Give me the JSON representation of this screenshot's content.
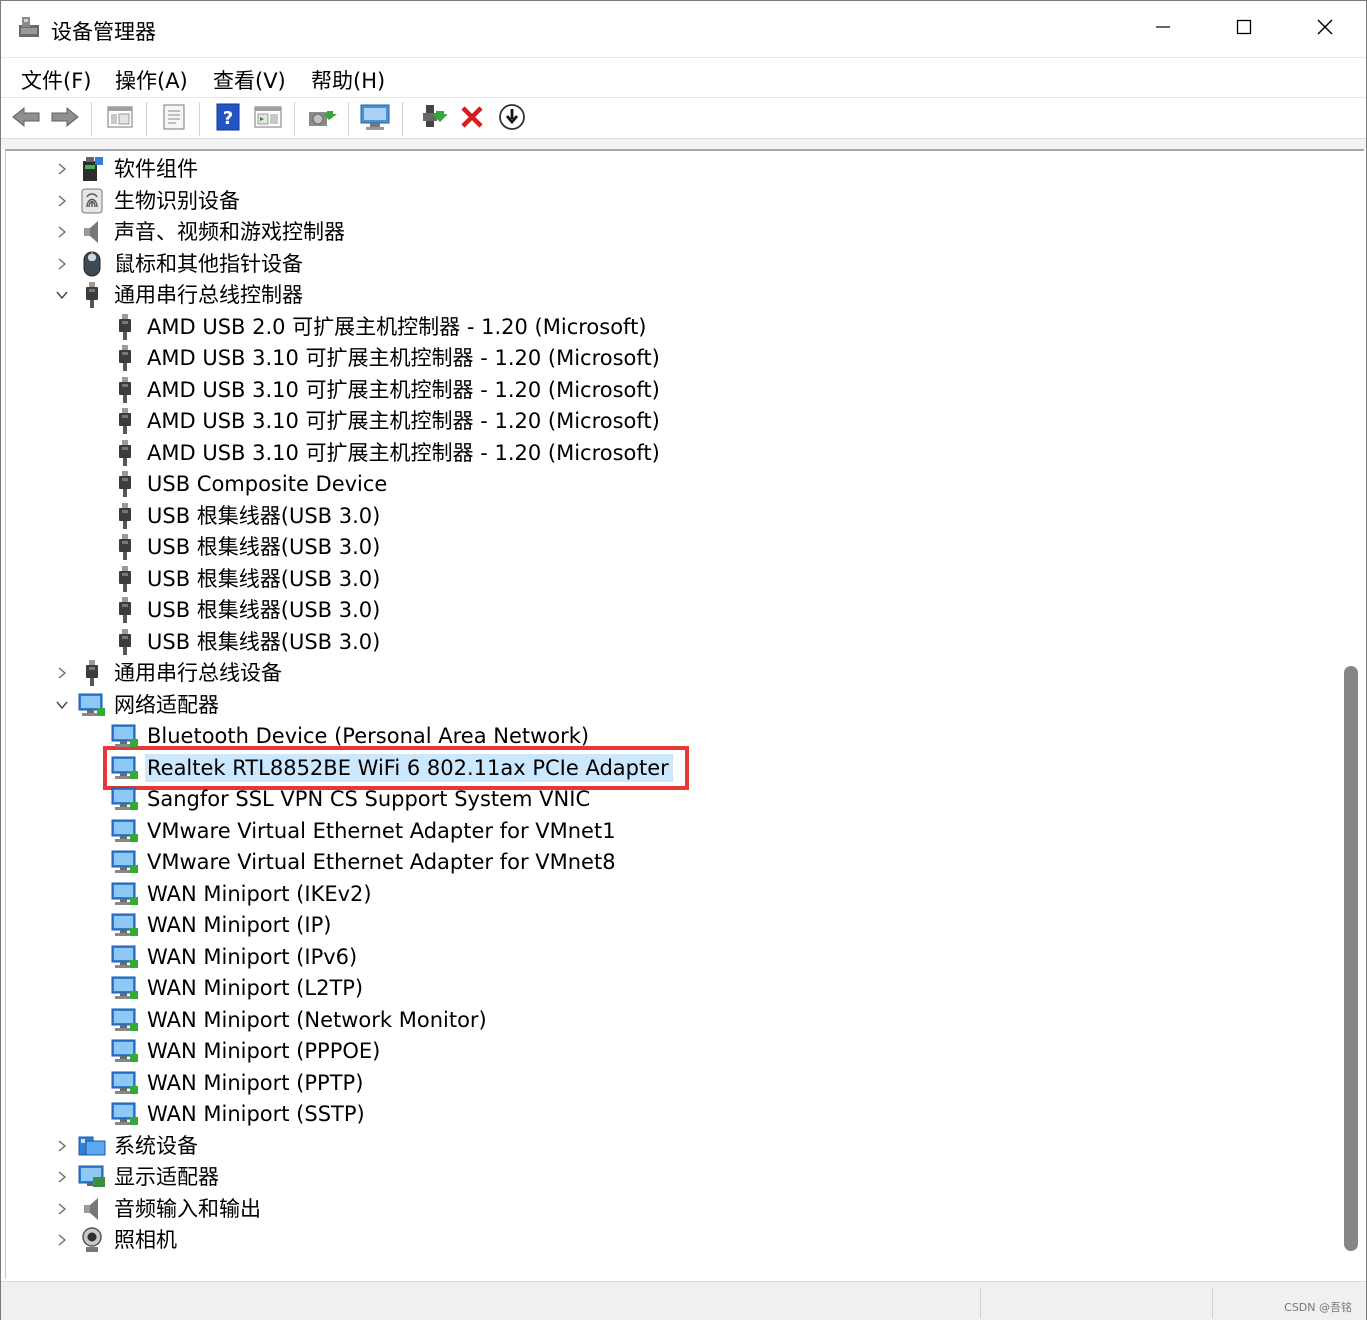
{
  "window": {
    "title": "设备管理器"
  },
  "menu": [
    "文件(F)",
    "操作(A)",
    "查看(V)",
    "帮助(H)"
  ],
  "toolbar": {
    "icons": [
      "back-arrow",
      "forward-arrow",
      "console-tree",
      "properties",
      "help",
      "action-pane",
      "update-driver",
      "scan-hardware",
      "enable-device",
      "uninstall-device",
      "disable-device"
    ]
  },
  "tree": {
    "rows": [
      {
        "label": "软件组件",
        "level": 0,
        "expanded": false,
        "icon": "software-component"
      },
      {
        "label": "生物识别设备",
        "level": 0,
        "expanded": false,
        "icon": "fingerprint"
      },
      {
        "label": "声音、视频和游戏控制器",
        "level": 0,
        "expanded": false,
        "icon": "speaker"
      },
      {
        "label": "鼠标和其他指针设备",
        "level": 0,
        "expanded": false,
        "icon": "mouse"
      },
      {
        "label": "通用串行总线控制器",
        "level": 0,
        "expanded": true,
        "icon": "usb"
      },
      {
        "label": "AMD USB 2.0 可扩展主机控制器 - 1.20 (Microsoft)",
        "level": 1,
        "icon": "usb"
      },
      {
        "label": "AMD USB 3.10 可扩展主机控制器 - 1.20 (Microsoft)",
        "level": 1,
        "icon": "usb"
      },
      {
        "label": "AMD USB 3.10 可扩展主机控制器 - 1.20 (Microsoft)",
        "level": 1,
        "icon": "usb"
      },
      {
        "label": "AMD USB 3.10 可扩展主机控制器 - 1.20 (Microsoft)",
        "level": 1,
        "icon": "usb"
      },
      {
        "label": "AMD USB 3.10 可扩展主机控制器 - 1.20 (Microsoft)",
        "level": 1,
        "icon": "usb"
      },
      {
        "label": "USB Composite Device",
        "level": 1,
        "icon": "usb"
      },
      {
        "label": "USB 根集线器(USB 3.0)",
        "level": 1,
        "icon": "usb"
      },
      {
        "label": "USB 根集线器(USB 3.0)",
        "level": 1,
        "icon": "usb"
      },
      {
        "label": "USB 根集线器(USB 3.0)",
        "level": 1,
        "icon": "usb"
      },
      {
        "label": "USB 根集线器(USB 3.0)",
        "level": 1,
        "icon": "usb"
      },
      {
        "label": "USB 根集线器(USB 3.0)",
        "level": 1,
        "icon": "usb"
      },
      {
        "label": "通用串行总线设备",
        "level": 0,
        "expanded": false,
        "icon": "usb"
      },
      {
        "label": "网络适配器",
        "level": 0,
        "expanded": true,
        "icon": "network"
      },
      {
        "label": "Bluetooth Device (Personal Area Network)",
        "level": 1,
        "icon": "network"
      },
      {
        "label": "Realtek RTL8852BE WiFi 6 802.11ax PCIe Adapter",
        "level": 1,
        "icon": "network",
        "selected": true
      },
      {
        "label": "Sangfor SSL VPN CS Support System VNIC",
        "level": 1,
        "icon": "network"
      },
      {
        "label": "VMware Virtual Ethernet Adapter for VMnet1",
        "level": 1,
        "icon": "network"
      },
      {
        "label": "VMware Virtual Ethernet Adapter for VMnet8",
        "level": 1,
        "icon": "network"
      },
      {
        "label": "WAN Miniport (IKEv2)",
        "level": 1,
        "icon": "network"
      },
      {
        "label": "WAN Miniport (IP)",
        "level": 1,
        "icon": "network"
      },
      {
        "label": "WAN Miniport (IPv6)",
        "level": 1,
        "icon": "network"
      },
      {
        "label": "WAN Miniport (L2TP)",
        "level": 1,
        "icon": "network"
      },
      {
        "label": "WAN Miniport (Network Monitor)",
        "level": 1,
        "icon": "network"
      },
      {
        "label": "WAN Miniport (PPPOE)",
        "level": 1,
        "icon": "network"
      },
      {
        "label": "WAN Miniport (PPTP)",
        "level": 1,
        "icon": "network"
      },
      {
        "label": "WAN Miniport (SSTP)",
        "level": 1,
        "icon": "network"
      },
      {
        "label": "系统设备",
        "level": 0,
        "expanded": false,
        "icon": "system"
      },
      {
        "label": "显示适配器",
        "level": 0,
        "expanded": false,
        "icon": "display"
      },
      {
        "label": "音频输入和输出",
        "level": 0,
        "expanded": false,
        "icon": "speaker"
      },
      {
        "label": "照相机",
        "level": 0,
        "expanded": false,
        "icon": "camera"
      }
    ]
  },
  "watermark": "CSDN @吾铭",
  "colors": {
    "selection": "#cce8ff",
    "highlight_box": "#e53935",
    "scroll_thumb": "#868686"
  }
}
